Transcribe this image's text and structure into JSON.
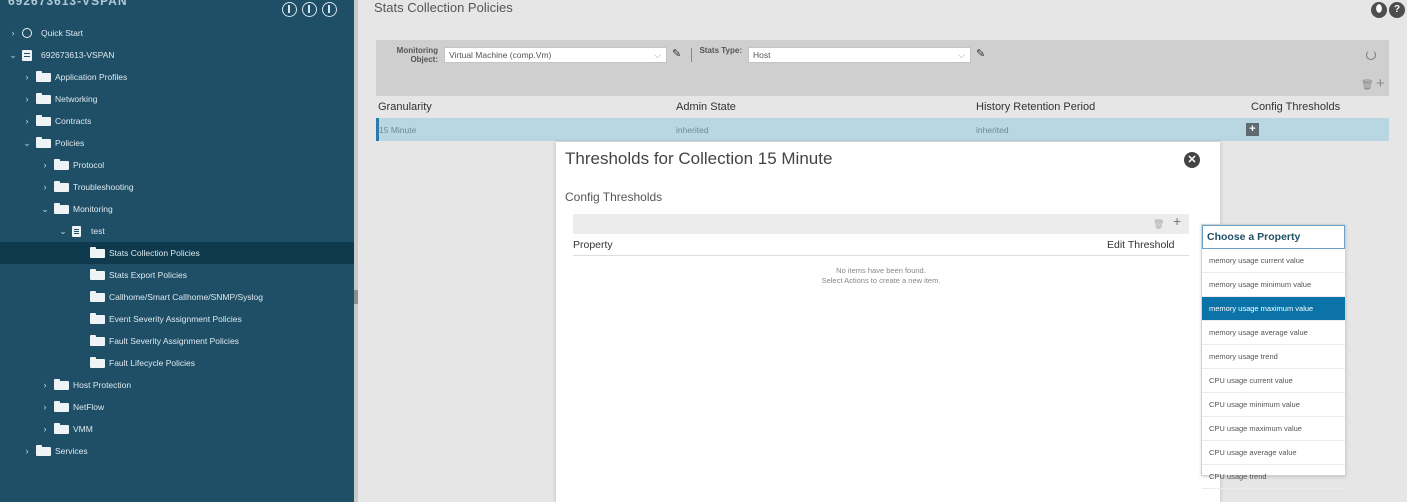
{
  "sidebar": {
    "title": "692673613-VSPAN",
    "items": [
      {
        "label": "Quick Start",
        "icon": "quick-start-icon",
        "chevron": ">",
        "level": 0
      },
      {
        "label": "692673613-VSPAN",
        "icon": "server-icon",
        "chevron": "v",
        "level": 0
      },
      {
        "label": "Application Profiles",
        "icon": "folder-icon",
        "chevron": ">",
        "level": 1
      },
      {
        "label": "Networking",
        "icon": "folder-icon",
        "chevron": ">",
        "level": 1
      },
      {
        "label": "Contracts",
        "icon": "folder-icon",
        "chevron": ">",
        "level": 1
      },
      {
        "label": "Policies",
        "icon": "folder-icon",
        "chevron": "v",
        "level": 1
      },
      {
        "label": "Protocol",
        "icon": "folder-icon",
        "chevron": ">",
        "level": 2
      },
      {
        "label": "Troubleshooting",
        "icon": "folder-icon",
        "chevron": ">",
        "level": 2
      },
      {
        "label": "Monitoring",
        "icon": "folder-icon",
        "chevron": "v",
        "level": 2
      },
      {
        "label": "test",
        "icon": "document-icon",
        "chevron": "v",
        "level": 3
      },
      {
        "label": "Stats Collection Policies",
        "icon": "folder-icon",
        "chevron": "",
        "level": 4,
        "selected": true
      },
      {
        "label": "Stats Export Policies",
        "icon": "folder-icon",
        "chevron": "",
        "level": 4
      },
      {
        "label": "Callhome/Smart Callhome/SNMP/Syslog",
        "icon": "folder-icon",
        "chevron": "",
        "level": 4
      },
      {
        "label": "Event Severity Assignment Policies",
        "icon": "folder-icon",
        "chevron": "",
        "level": 4
      },
      {
        "label": "Fault Severity Assignment Policies",
        "icon": "folder-icon",
        "chevron": "",
        "level": 4
      },
      {
        "label": "Fault Lifecycle Policies",
        "icon": "folder-icon",
        "chevron": "",
        "level": 4
      },
      {
        "label": "Host Protection",
        "icon": "folder-icon",
        "chevron": ">",
        "level": 2
      },
      {
        "label": "NetFlow",
        "icon": "folder-icon",
        "chevron": ">",
        "level": 2
      },
      {
        "label": "VMM",
        "icon": "folder-icon",
        "chevron": ">",
        "level": 2
      },
      {
        "label": "Services",
        "icon": "folder-icon",
        "chevron": ">",
        "level": 1
      }
    ]
  },
  "main": {
    "title": "Stats Collection Policies",
    "filters": {
      "monitoring_object_label": "Monitoring Object:",
      "monitoring_object_value": "Virtual Machine (comp.Vm)",
      "stats_type_label": "Stats Type:",
      "stats_type_value": "Host"
    },
    "table": {
      "columns": [
        "Granularity",
        "Admin State",
        "History Retention Period",
        "Config Thresholds"
      ],
      "rows": [
        {
          "granularity": "15 Minute",
          "admin_state": "inherited",
          "history_retention": "inherited",
          "config_thresholds": "+"
        }
      ]
    }
  },
  "dialog": {
    "title": "Thresholds for Collection 15 Minute",
    "subtitle": "Config Thresholds",
    "columns": [
      "Property",
      "Edit Threshold"
    ],
    "empty_line1": "No items have been found.",
    "empty_line2": "Select Actions to create a new item."
  },
  "property_menu": {
    "title": "Choose a Property",
    "items": [
      "memory usage current value",
      "memory usage minimum value",
      "memory usage maximum value",
      "memory usage average value",
      "memory usage trend",
      "CPU usage current value",
      "CPU usage minimum value",
      "CPU usage maximum value",
      "CPU usage average value",
      "CPU usage trend"
    ],
    "selected": "memory usage maximum value"
  },
  "colors": {
    "sidebar_bg": "#1f4f66",
    "selected_row": "#b9d6e3",
    "menu_active": "#0b73a8"
  }
}
